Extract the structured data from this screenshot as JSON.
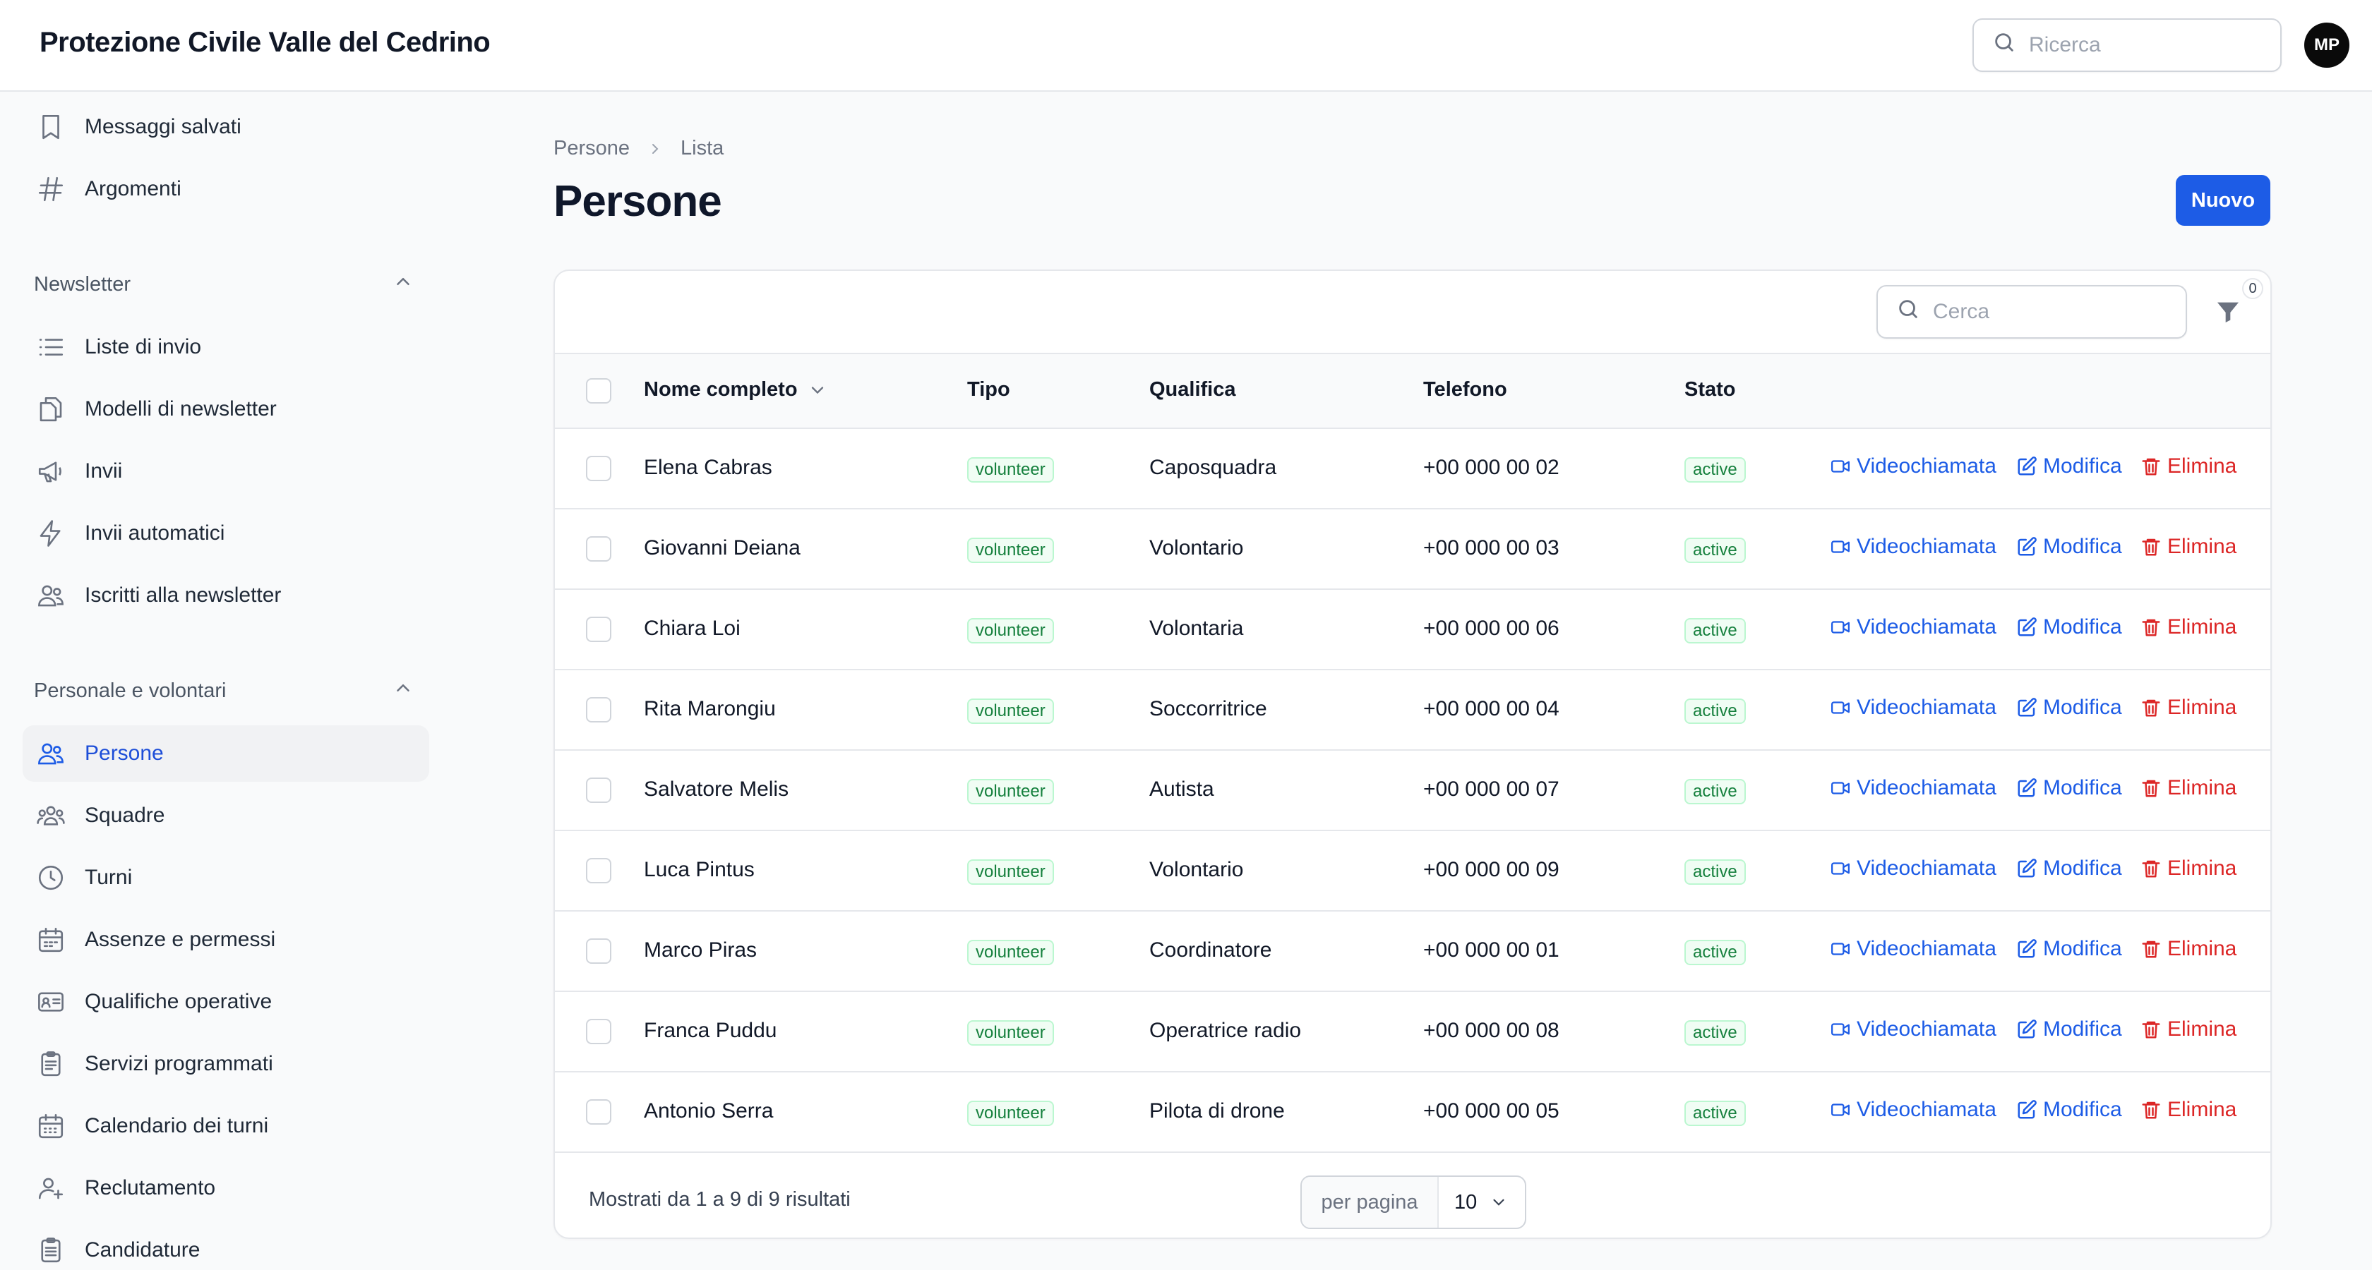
{
  "app": {
    "title": "Protezione Civile Valle del Cedrino"
  },
  "topbar": {
    "search_placeholder": "Ricerca",
    "avatar_initials": "MP"
  },
  "sidebar": {
    "top_items": [
      {
        "label": "Messaggi salvati",
        "icon": "bookmark-icon"
      },
      {
        "label": "Argomenti",
        "icon": "hashtag-icon"
      }
    ],
    "groups": [
      {
        "label": "Newsletter",
        "items": [
          {
            "label": "Liste di invio",
            "icon": "list-icon"
          },
          {
            "label": "Modelli di newsletter",
            "icon": "document-duplicate-icon"
          },
          {
            "label": "Invii",
            "icon": "megaphone-icon"
          },
          {
            "label": "Invii automatici",
            "icon": "bolt-icon"
          },
          {
            "label": "Iscritti alla newsletter",
            "icon": "users-icon"
          }
        ]
      },
      {
        "label": "Personale e volontari",
        "items": [
          {
            "label": "Persone",
            "icon": "users-icon",
            "active": true
          },
          {
            "label": "Squadre",
            "icon": "user-group-icon"
          },
          {
            "label": "Turni",
            "icon": "clock-icon"
          },
          {
            "label": "Assenze e permessi",
            "icon": "calendar-icon"
          },
          {
            "label": "Qualifiche operative",
            "icon": "identification-icon"
          },
          {
            "label": "Servizi programmati",
            "icon": "clipboard-icon"
          },
          {
            "label": "Calendario dei turni",
            "icon": "calendar-days-icon"
          },
          {
            "label": "Reclutamento",
            "icon": "user-plus-icon"
          },
          {
            "label": "Candidature",
            "icon": "clipboard-document-icon"
          }
        ]
      }
    ]
  },
  "breadcrumb": {
    "root": "Persone",
    "current": "Lista"
  },
  "page": {
    "title": "Persone",
    "new_button": "Nuovo"
  },
  "table": {
    "search_placeholder": "Cerca",
    "filter_count": "0",
    "columns": [
      "Nome completo",
      "Tipo",
      "Qualifica",
      "Telefono",
      "Stato"
    ],
    "actions": {
      "video": "Videochiamata",
      "edit": "Modifica",
      "delete": "Elimina"
    },
    "rows": [
      {
        "name": "Elena Cabras",
        "type": "volunteer",
        "role": "Caposquadra",
        "phone": "+00 000 00 02",
        "status": "active"
      },
      {
        "name": "Giovanni Deiana",
        "type": "volunteer",
        "role": "Volontario",
        "phone": "+00 000 00 03",
        "status": "active"
      },
      {
        "name": "Chiara Loi",
        "type": "volunteer",
        "role": "Volontaria",
        "phone": "+00 000 00 06",
        "status": "active"
      },
      {
        "name": "Rita Marongiu",
        "type": "volunteer",
        "role": "Soccorritrice",
        "phone": "+00 000 00 04",
        "status": "active"
      },
      {
        "name": "Salvatore Melis",
        "type": "volunteer",
        "role": "Autista",
        "phone": "+00 000 00 07",
        "status": "active"
      },
      {
        "name": "Luca Pintus",
        "type": "volunteer",
        "role": "Volontario",
        "phone": "+00 000 00 09",
        "status": "active"
      },
      {
        "name": "Marco Piras",
        "type": "volunteer",
        "role": "Coordinatore",
        "phone": "+00 000 00 01",
        "status": "active"
      },
      {
        "name": "Franca Puddu",
        "type": "volunteer",
        "role": "Operatrice radio",
        "phone": "+00 000 00 08",
        "status": "active"
      },
      {
        "name": "Antonio Serra",
        "type": "volunteer",
        "role": "Pilota di drone",
        "phone": "+00 000 00 05",
        "status": "active"
      }
    ],
    "footer": {
      "summary": "Mostrati da 1 a 9 di 9 risultati",
      "per_page_label": "per pagina",
      "per_page_value": "10"
    }
  },
  "colors": {
    "accent": "#1d5ce6",
    "danger": "#dc2626",
    "success": "#15803d"
  }
}
